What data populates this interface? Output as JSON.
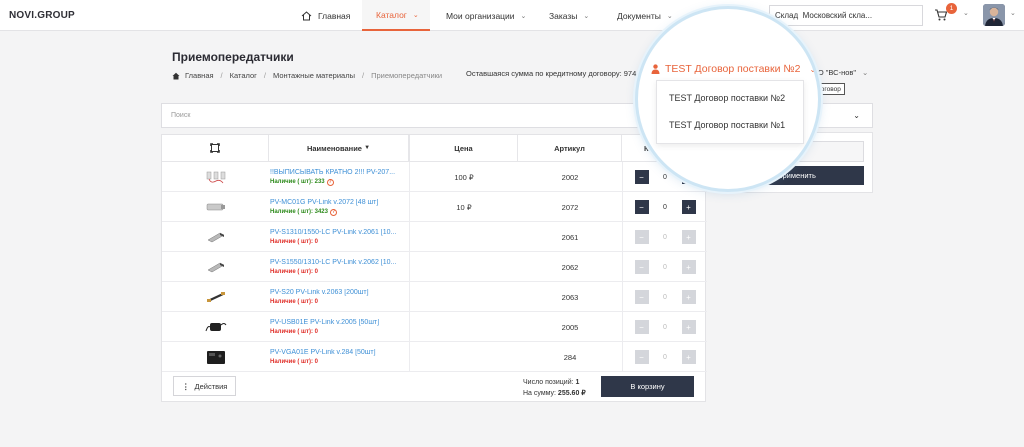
{
  "header": {
    "logo": "NOVI.GROUP",
    "nav": [
      {
        "label": "Главная",
        "icon": "home-icon"
      },
      {
        "label": "Каталог",
        "active": true
      },
      {
        "label": "Мои организации"
      },
      {
        "label": "Заказы"
      },
      {
        "label": "Документы"
      },
      {
        "label": "О"
      }
    ],
    "stock_label": "Склад",
    "stock_value": "Московский скла...",
    "cart_count": "1",
    "accent_color": "#e8643b"
  },
  "page": {
    "title": "Приемопередатчики",
    "breadcrumb": [
      "Главная",
      "Каталог",
      "Монтажные материалы",
      "Приемопередатчики"
    ],
    "credit_text": "Оставшаяся сумма по кредитному договору: 9744.4",
    "org_selector": "ОО \"ВС-нов\"",
    "contract_button": "договор"
  },
  "contract": {
    "selected": "TEST Договор поставки №2",
    "options": [
      "TEST Договор поставки №2",
      "TEST Договор поставки №1"
    ]
  },
  "search": {
    "placeholder": "Поиск"
  },
  "table": {
    "columns": {
      "name": "Наименование",
      "price": "Цена",
      "article": "Артикул",
      "qty": "Ко"
    },
    "rows": [
      {
        "name": "!!ВЫПИСЫВАТЬ КРАТНО 2!!! PV-207...",
        "availability": "Наличие ( шт): 233",
        "in_stock": true,
        "price": "100 ₽",
        "article": "2002",
        "qty": "0"
      },
      {
        "name": "PV-MC01G PV-Link v.2072 [48 шт]",
        "availability": "Наличие ( шт): 3423",
        "in_stock": true,
        "price": "10 ₽",
        "article": "2072",
        "qty": "0"
      },
      {
        "name": "PV-S1310/1550-LC PV-Link v.2061 [10...",
        "availability": "Наличие ( шт): 0",
        "in_stock": false,
        "price": "",
        "article": "2061",
        "qty": "0"
      },
      {
        "name": "PV-S1550/1310-LC PV-Link v.2062 [10...",
        "availability": "Наличие ( шт): 0",
        "in_stock": false,
        "price": "",
        "article": "2062",
        "qty": "0"
      },
      {
        "name": "PV-S20 PV-Link v.2063 [200шт]",
        "availability": "Наличие ( шт): 0",
        "in_stock": false,
        "price": "",
        "article": "2063",
        "qty": "0"
      },
      {
        "name": "PV-USB01E PV-Link v.2005 [50шт]",
        "availability": "Наличие ( шт): 0",
        "in_stock": false,
        "price": "",
        "article": "2005",
        "qty": "0"
      },
      {
        "name": "PV-VGA01E PV-Link v.284 [50шт]",
        "availability": "Наличие ( шт): 0",
        "in_stock": false,
        "price": "",
        "article": "284",
        "qty": "0"
      }
    ]
  },
  "footer": {
    "actions_label": "Действия",
    "positions_label": "Число позиций:",
    "positions_value": "1",
    "sum_label": "На сумму:",
    "sum_value": "255.60 ₽",
    "cart_button": "В корзину"
  },
  "filter_panel": {
    "reset_label": "ить",
    "apply_label": "Применить"
  }
}
